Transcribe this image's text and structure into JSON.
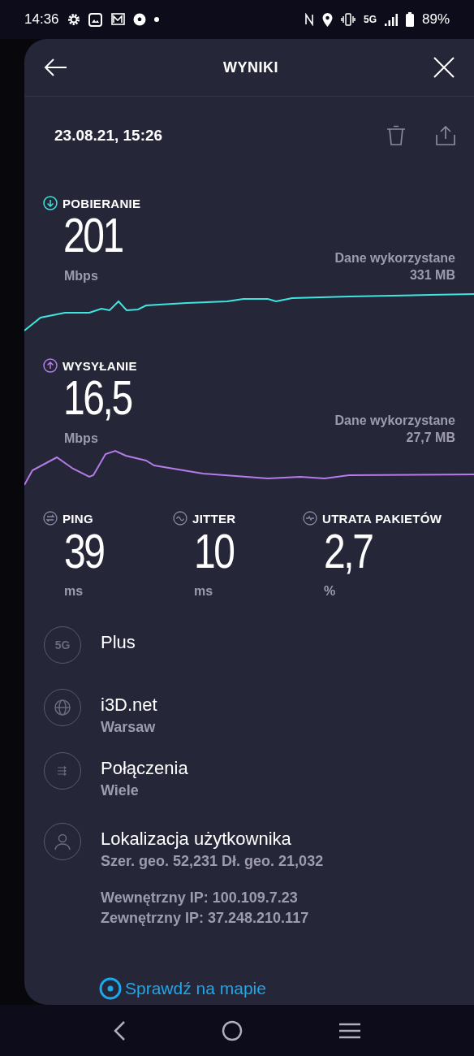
{
  "status_bar": {
    "time": "14:36",
    "network": "5G",
    "battery": "89%"
  },
  "header": {
    "title": "WYNIKI"
  },
  "date": "23.08.21, 15:26",
  "speeds": [
    {
      "kind": "download",
      "label": "POBIERANIE",
      "value": "201",
      "unit": "Mbps",
      "data_label": "Dane wykorzystane",
      "data_value": "331 MB",
      "color": "#3ee6e0"
    },
    {
      "kind": "upload",
      "label": "WYSYŁANIE",
      "value": "16,5",
      "unit": "Mbps",
      "data_label": "Dane wykorzystane",
      "data_value": "27,7 MB",
      "color": "#b57be8"
    }
  ],
  "stats": [
    {
      "kind": "ping",
      "label": "PING",
      "value": "39",
      "unit": "ms"
    },
    {
      "kind": "jitter",
      "label": "JITTER",
      "value": "10",
      "unit": "ms"
    },
    {
      "kind": "loss",
      "label": "UTRATA PAKIETÓW",
      "value": "2,7",
      "unit": "%"
    }
  ],
  "details": [
    {
      "kind": "network",
      "badge": "5G",
      "title": "Plus"
    },
    {
      "kind": "server",
      "title": "i3D.net",
      "subtitle": "Warsaw"
    },
    {
      "kind": "connections",
      "title": "Połączenia",
      "subtitle": "Wiele"
    },
    {
      "kind": "user",
      "title": "Lokalizacja użytkownika",
      "subtitle": "Szer. geo. 52,231 Dł. geo. 21,032"
    }
  ],
  "ip_lines": [
    "Wewnętrzny IP: 100.109.7.23",
    "Zewnętrzny IP: 37.248.210.117"
  ],
  "map_link": "Sprawdź na mapie"
}
